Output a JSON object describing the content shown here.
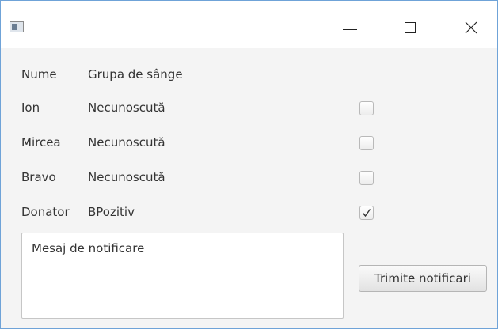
{
  "window": {
    "icons": {
      "app": "app-window-icon",
      "minimize": "minimize-icon",
      "maximize": "maximize-icon",
      "close": "close-icon"
    }
  },
  "table": {
    "header": {
      "name": "Nume",
      "blood_type": "Grupa de sânge"
    },
    "rows": [
      {
        "name": "Ion",
        "blood_type": "Necunoscută",
        "checked": false
      },
      {
        "name": "Mircea",
        "blood_type": "Necunoscută",
        "checked": false
      },
      {
        "name": "Bravo",
        "blood_type": "Necunoscută",
        "checked": false
      },
      {
        "name": "Donator",
        "blood_type": "BPozitiv",
        "checked": true
      }
    ]
  },
  "notification": {
    "message": "Mesaj de notificare",
    "send_label": "Trimite notificari"
  },
  "colors": {
    "window_border": "#6fa3d8",
    "background": "#f4f4f4",
    "text": "#333333"
  }
}
